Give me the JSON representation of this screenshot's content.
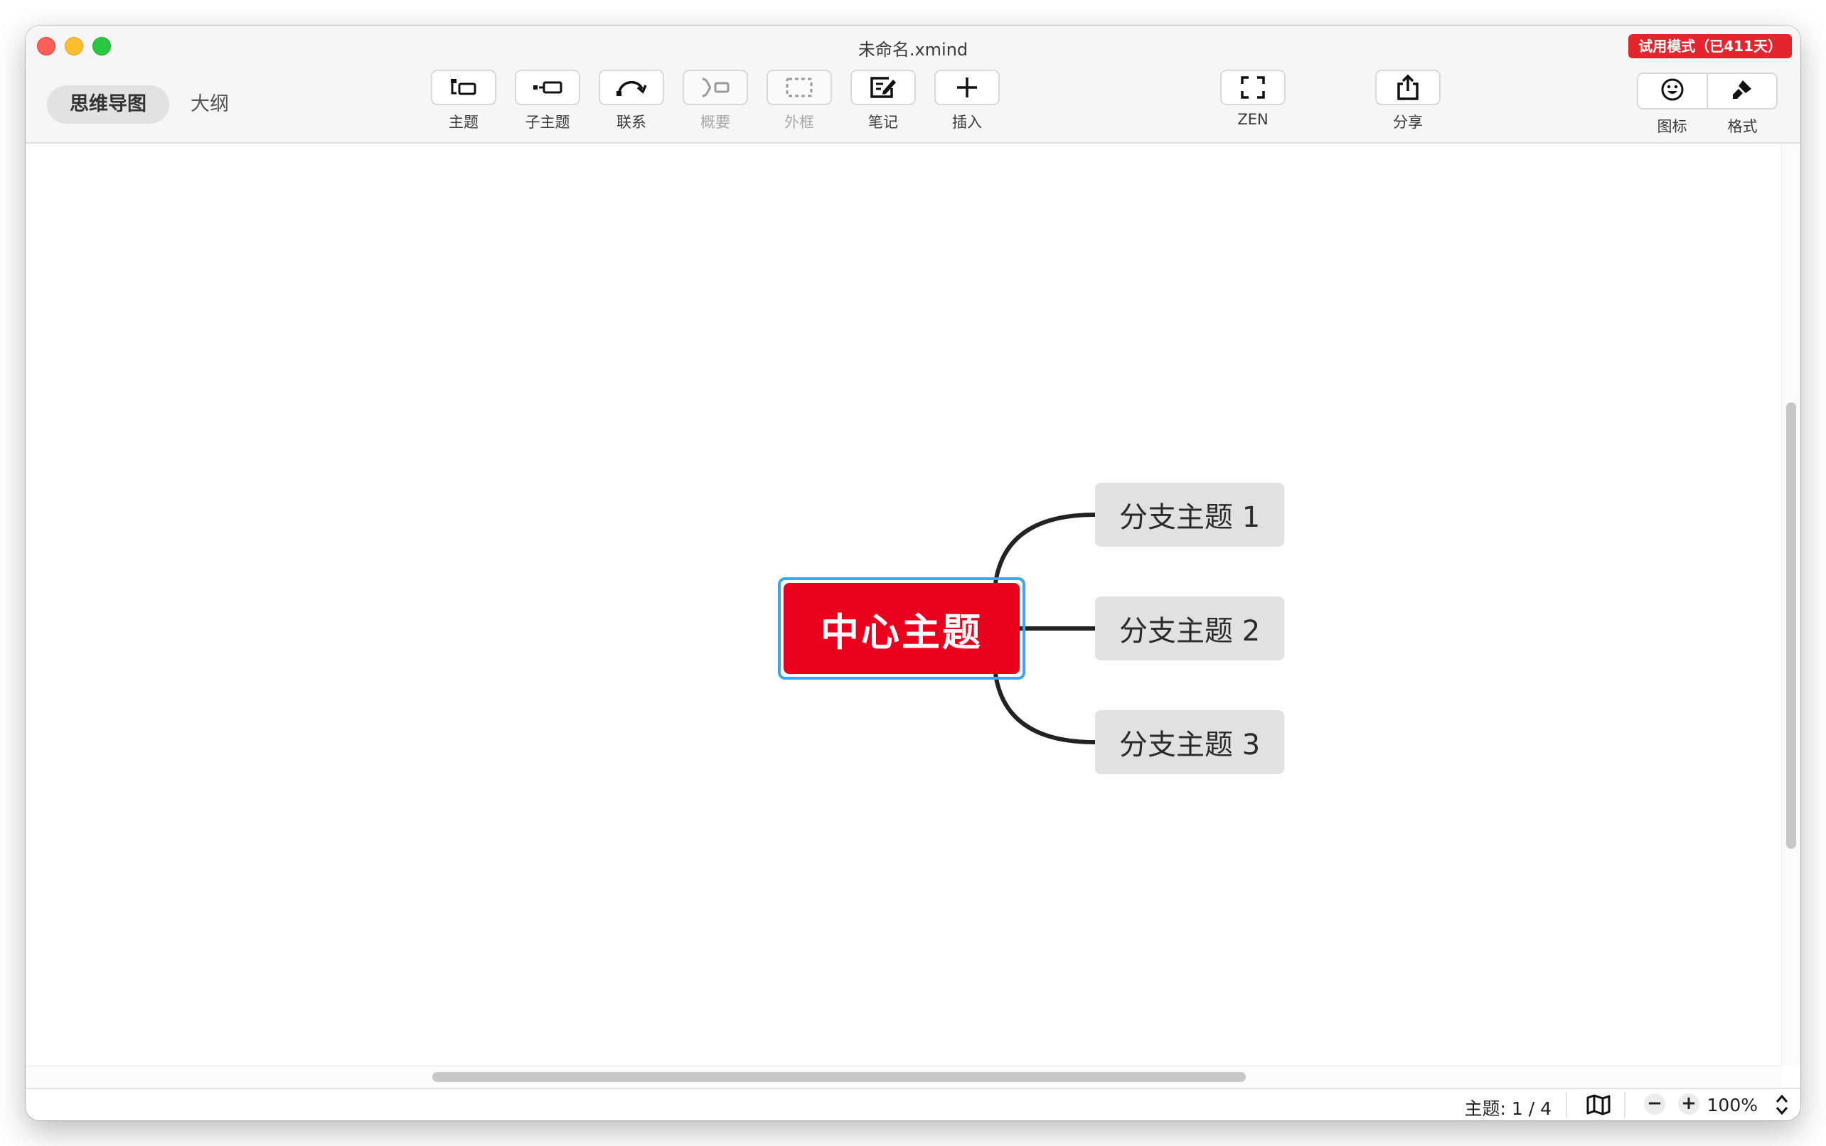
{
  "window": {
    "title": "未命名.xmind",
    "trial_badge": "试用模式（已411天）"
  },
  "view_tabs": [
    {
      "label": "思维导图",
      "active": true
    },
    {
      "label": "大纲",
      "active": false
    }
  ],
  "toolbar": {
    "topic": {
      "label": "主题",
      "icon": "topic-icon",
      "enabled": true
    },
    "subtopic": {
      "label": "子主题",
      "icon": "subtopic-icon",
      "enabled": true
    },
    "relationship": {
      "label": "联系",
      "icon": "relationship-icon",
      "enabled": true
    },
    "summary": {
      "label": "概要",
      "icon": "summary-icon",
      "enabled": false
    },
    "boundary": {
      "label": "外框",
      "icon": "boundary-icon",
      "enabled": false
    },
    "notes": {
      "label": "笔记",
      "icon": "notes-icon",
      "enabled": true
    },
    "insert": {
      "label": "插入",
      "icon": "plus-icon",
      "enabled": true
    },
    "zen": {
      "label": "ZEN",
      "icon": "fullscreen-icon",
      "enabled": true
    },
    "share": {
      "label": "分享",
      "icon": "share-icon",
      "enabled": true
    },
    "icons_panel": {
      "label": "图标",
      "icon": "smiley-icon"
    },
    "format_panel": {
      "label": "格式",
      "icon": "brush-icon"
    }
  },
  "mindmap": {
    "central_topic": "中心主题",
    "central_color": "#e8001c",
    "selection_color": "#3ca6f0",
    "branches": [
      {
        "label": "分支主题 1"
      },
      {
        "label": "分支主题 2"
      },
      {
        "label": "分支主题 3"
      }
    ]
  },
  "statusbar": {
    "topic_count": "主题: 1 / 4",
    "zoom_out": "−",
    "zoom_in": "+",
    "zoom_level": "100%"
  },
  "colors": {
    "trial_badge": "#e3252e",
    "branch_fill": "#e1e1e1",
    "connector": "#222222"
  }
}
